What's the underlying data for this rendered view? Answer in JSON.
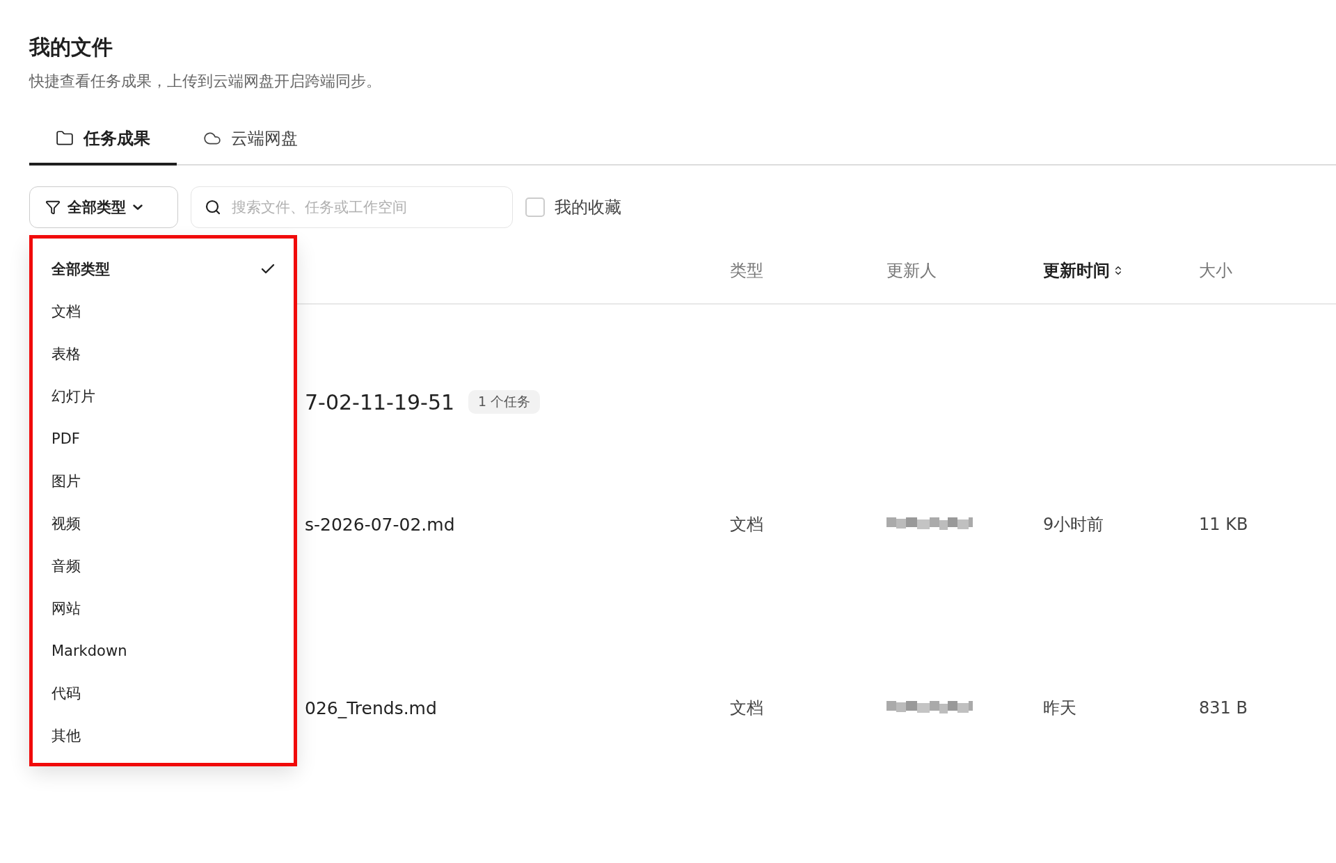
{
  "page": {
    "title": "我的文件",
    "subtitle": "快捷查看任务成果，上传到云端网盘开启跨端同步。"
  },
  "tabs": [
    {
      "label": "任务成果",
      "selected": true
    },
    {
      "label": "云端网盘",
      "selected": false
    }
  ],
  "toolbar": {
    "filter_label": "全部类型",
    "search_placeholder": "搜索文件、任务或工作空间",
    "favorites": {
      "label": "我的收藏",
      "checked": false
    }
  },
  "type_menu": {
    "items": [
      {
        "label": "全部类型",
        "selected": true
      },
      {
        "label": "文档",
        "selected": false
      },
      {
        "label": "表格",
        "selected": false
      },
      {
        "label": "幻灯片",
        "selected": false
      },
      {
        "label": "PDF",
        "selected": false
      },
      {
        "label": "图片",
        "selected": false
      },
      {
        "label": "视频",
        "selected": false
      },
      {
        "label": "音频",
        "selected": false
      },
      {
        "label": "网站",
        "selected": false
      },
      {
        "label": "Markdown",
        "selected": false
      },
      {
        "label": "代码",
        "selected": false
      },
      {
        "label": "其他",
        "selected": false
      }
    ]
  },
  "table": {
    "columns": [
      {
        "label": "类型",
        "sorted": false
      },
      {
        "label": "更新人",
        "sorted": false
      },
      {
        "label": "更新时间",
        "sorted": true
      },
      {
        "label": "大小",
        "sorted": false
      }
    ],
    "rows": [
      {
        "kind": "group",
        "name": "7-02-11-19-51",
        "badge": "1 个任务"
      },
      {
        "kind": "file",
        "name": "s-2026-07-02.md",
        "type": "文档",
        "updater_redacted": true,
        "updated": "9小时前",
        "size": "11 KB"
      },
      {
        "kind": "file",
        "name": "026_Trends.md",
        "type": "文档",
        "updater_redacted": true,
        "updated": "昨天",
        "size": "831 B"
      }
    ]
  },
  "annotation": {
    "highlight": true
  }
}
